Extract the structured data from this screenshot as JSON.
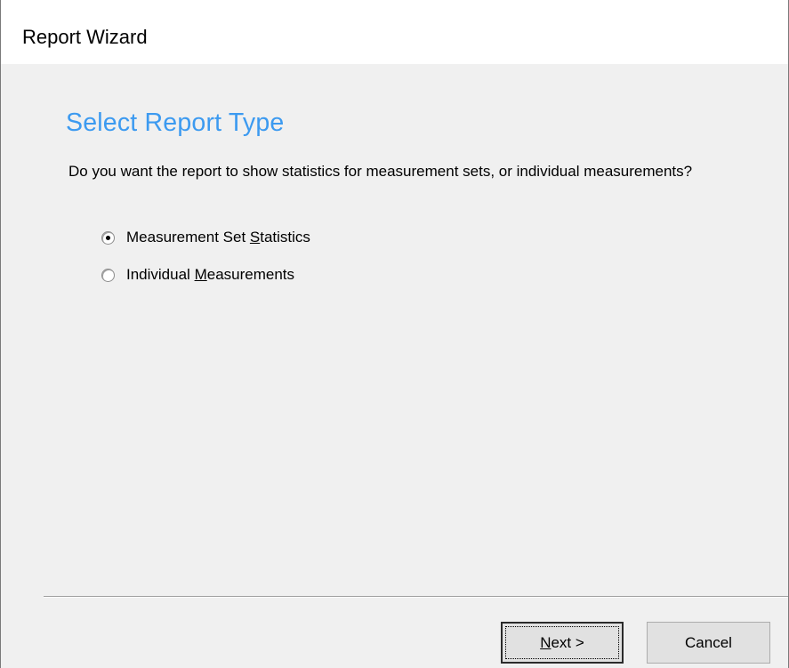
{
  "window": {
    "title": "Report Wizard"
  },
  "page": {
    "heading": "Select Report Type",
    "question": "Do you want the report to show statistics for measurement sets, or individual measurements?"
  },
  "options": [
    {
      "label_pre": "Measurement Set ",
      "label_accel": "S",
      "label_post": "tatistics",
      "selected": true
    },
    {
      "label_pre": "Individual ",
      "label_accel": "M",
      "label_post": "easurements",
      "selected": false
    }
  ],
  "buttons": {
    "next_accel": "N",
    "next_rest": "ext >",
    "cancel": "Cancel"
  },
  "colors": {
    "heading": "#3c9af0",
    "background": "#f0f0f0",
    "titlebar": "#ffffff"
  }
}
